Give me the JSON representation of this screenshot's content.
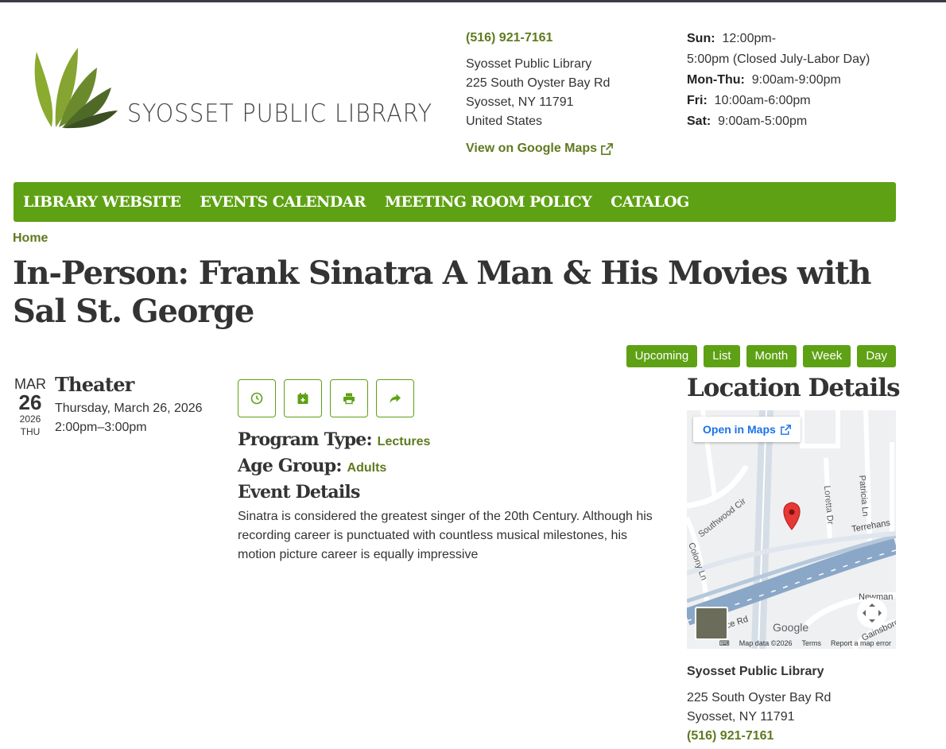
{
  "header": {
    "logo_text": "SYOSSET PUBLIC LIBRARY",
    "phone": "(516) 921-7161",
    "address": [
      "Syosset Public Library",
      "225 South Oyster Bay Rd",
      "Syosset, NY 11791",
      "United States"
    ],
    "maps_link": "View on Google Maps",
    "hours": [
      {
        "day": "Sun:",
        "time": "12:00pm-"
      },
      {
        "day": "",
        "time": "5:00pm (Closed July-Labor Day)"
      },
      {
        "day": "Mon-Thu:",
        "time": "9:00am-9:00pm"
      },
      {
        "day": "Fri:",
        "time": "10:00am-6:00pm"
      },
      {
        "day": "Sat:",
        "time": "9:00am-5:00pm"
      }
    ]
  },
  "nav": [
    "LIBRARY WEBSITE",
    "EVENTS CALENDAR",
    "MEETING ROOM POLICY",
    "CATALOG"
  ],
  "breadcrumb": "Home",
  "title": "In-Person: Frank Sinatra A Man & His Movies with Sal St. George",
  "views": [
    "Upcoming",
    "List",
    "Month",
    "Week",
    "Day"
  ],
  "event": {
    "month": "MAR",
    "day": "26",
    "year": "2026",
    "dow": "THU",
    "location_name": "Theater",
    "date_long": "Thursday, March 26, 2026",
    "time": "2:00pm–3:00pm",
    "program_type_label": "Program Type:",
    "program_type": "Lectures",
    "age_group_label": "Age Group:",
    "age_group": "Adults",
    "details_label": "Event Details",
    "description": "Sinatra is considered the greatest singer of the 20th Century. Although his recording career is punctuated with countless musical milestones, his motion picture career is equally impressive"
  },
  "location": {
    "heading": "Location Details",
    "open_in_maps": "Open in Maps",
    "map_labels": [
      "Southwood Cir",
      "Colony Ln",
      "Loretta Dr",
      "Patricia Ln",
      "Terrehans",
      "Newman",
      "Gainsboro",
      "ice Rd"
    ],
    "map_footer": [
      "Map data ©2026",
      "Terms",
      "Report a map error"
    ],
    "google": "Google",
    "name": "Syosset Public Library",
    "street": "225 South Oyster Bay Rd",
    "city": "Syosset, NY 11791",
    "phone": "(516) 921-7161"
  },
  "colors": {
    "accent": "#5ea114",
    "link": "#5f7a1f",
    "map_pin": "#e53935"
  }
}
